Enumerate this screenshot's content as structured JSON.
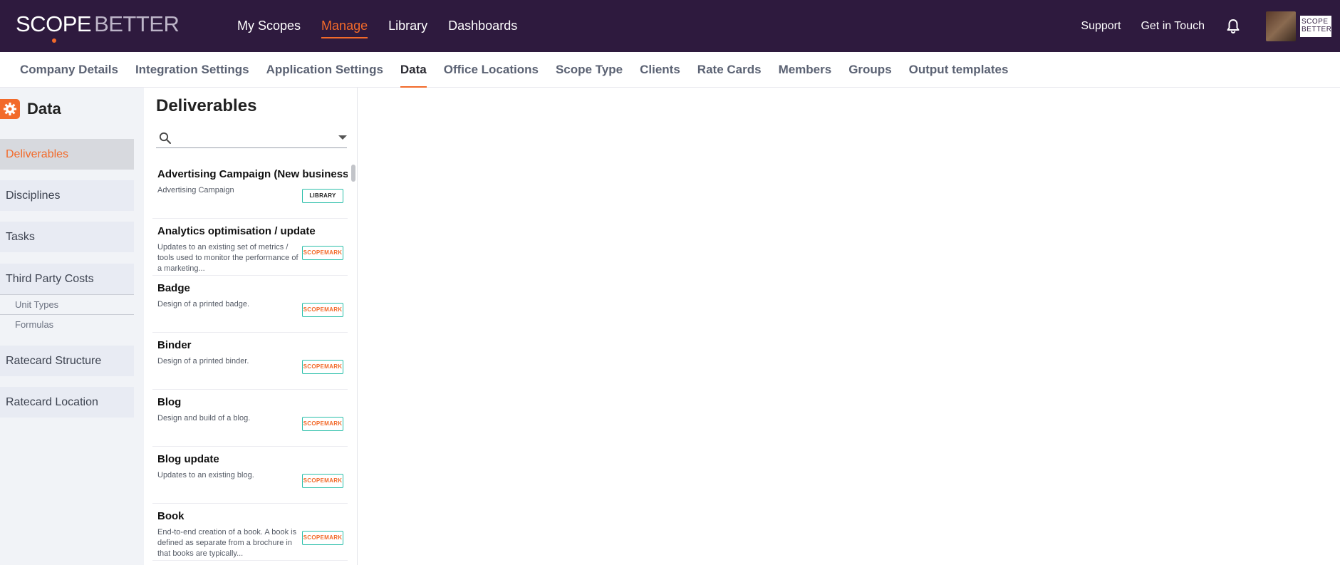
{
  "app": {
    "logo_part1": "SC",
    "logo_o": "O",
    "logo_part2": "PE",
    "logo_part3": "BETTER",
    "mini_logo_line1": "SCOPE",
    "mini_logo_line2": "BETTER"
  },
  "main_nav": [
    {
      "label": "My Scopes"
    },
    {
      "label": "Manage"
    },
    {
      "label": "Library"
    },
    {
      "label": "Dashboards"
    }
  ],
  "right_nav": {
    "support": "Support",
    "get_in_touch": "Get in Touch"
  },
  "sub_nav": [
    {
      "label": "Company Details"
    },
    {
      "label": "Integration Settings"
    },
    {
      "label": "Application Settings"
    },
    {
      "label": "Data"
    },
    {
      "label": "Office Locations"
    },
    {
      "label": "Scope Type"
    },
    {
      "label": "Clients"
    },
    {
      "label": "Rate Cards"
    },
    {
      "label": "Members"
    },
    {
      "label": "Groups"
    },
    {
      "label": "Output templates"
    }
  ],
  "sidebar": {
    "title": "Data",
    "items": [
      {
        "label": "Deliverables"
      },
      {
        "label": "Disciplines"
      },
      {
        "label": "Tasks"
      },
      {
        "label": "Third Party Costs"
      },
      {
        "label": "Unit Types"
      },
      {
        "label": "Formulas"
      },
      {
        "label": "Ratecard Structure"
      },
      {
        "label": "Ratecard Location"
      }
    ]
  },
  "list": {
    "title": "Deliverables",
    "search_placeholder": "",
    "items": [
      {
        "title": "Advertising Campaign (New business)",
        "desc": "Advertising Campaign",
        "badge": "LIBRARY"
      },
      {
        "title": "Analytics optimisation / update",
        "desc": "Updates to an existing set of metrics / tools used to monitor the performance of a marketing...",
        "badge": "SCOPEMARK"
      },
      {
        "title": "Badge",
        "desc": "Design of a printed badge.",
        "badge": "SCOPEMARK"
      },
      {
        "title": "Binder",
        "desc": "Design of a printed binder.",
        "badge": "SCOPEMARK"
      },
      {
        "title": "Blog",
        "desc": "Design and build of a blog.",
        "badge": "SCOPEMARK"
      },
      {
        "title": "Blog update",
        "desc": "Updates to an existing blog.",
        "badge": "SCOPEMARK"
      },
      {
        "title": "Book",
        "desc": "End-to-end creation of a book. A book is defined as separate from a brochure in that books are typically...",
        "badge": "SCOPEMARK"
      }
    ]
  },
  "colors": {
    "topbar": "#2e1a3e",
    "accent": "#f26a2a",
    "badge_border": "#2bbfaa"
  },
  "icons": [
    "bell-icon",
    "gear-icon",
    "search-icon",
    "chevron-down-icon"
  ]
}
